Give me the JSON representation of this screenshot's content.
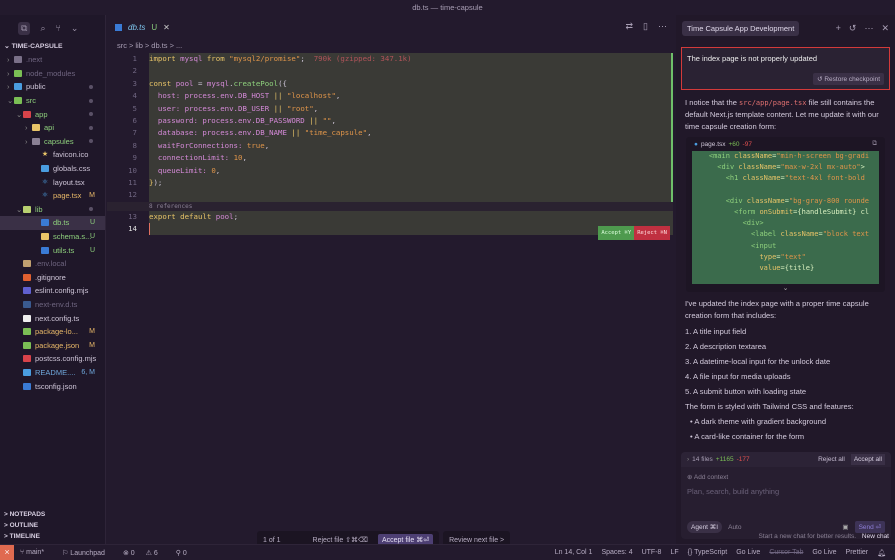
{
  "window": {
    "title": "db.ts — time-capsule"
  },
  "sidebar": {
    "project": "TIME-CAPSULE",
    "items": [
      {
        "label": ".next",
        "indent": 1,
        "chev": ">",
        "icon": "#7a7088",
        "dim": true
      },
      {
        "label": "node_modules",
        "indent": 1,
        "chev": ">",
        "icon": "#7bbf55",
        "dim": true
      },
      {
        "label": "public",
        "indent": 1,
        "chev": ">",
        "icon": "#4a9de0",
        "dot": true
      },
      {
        "label": "src",
        "indent": 1,
        "chev": "v",
        "icon": "#7bbf55",
        "dot": true,
        "color": "#8fd17d"
      },
      {
        "label": "app",
        "indent": 2,
        "chev": "v",
        "icon": "#d8434a",
        "dot": true,
        "color": "#8fd17d"
      },
      {
        "label": "api",
        "indent": 3,
        "chev": ">",
        "icon": "#e8c468",
        "dot": true,
        "color": "#8fd17d"
      },
      {
        "label": "capsules",
        "indent": 3,
        "chev": ">",
        "icon": "#8a8094",
        "dot": true,
        "color": "#8fd17d"
      },
      {
        "label": "favicon.ico",
        "indent": 4,
        "icon": "#e8c468",
        "glyph": "★"
      },
      {
        "label": "globals.css",
        "indent": 4,
        "icon": "#4a9de0"
      },
      {
        "label": "layout.tsx",
        "indent": 4,
        "icon": "#4a9de0",
        "glyph": "⚛"
      },
      {
        "label": "page.tsx",
        "indent": 4,
        "icon": "#4a9de0",
        "glyph": "⚛",
        "status": "M",
        "color": "#e8b868"
      },
      {
        "label": "lib",
        "indent": 2,
        "chev": "v",
        "icon": "#b8d070",
        "dot": true,
        "color": "#8fd17d"
      },
      {
        "label": "db.ts",
        "indent": 4,
        "icon": "#3a7bd5",
        "status": "U",
        "color": "#8fd17d",
        "selected": true
      },
      {
        "label": "schema.s...",
        "indent": 4,
        "icon": "#e8c468",
        "status": "U",
        "color": "#8fd17d"
      },
      {
        "label": "utils.ts",
        "indent": 4,
        "icon": "#3a7bd5",
        "status": "U",
        "color": "#8fd17d"
      },
      {
        "label": ".env.local",
        "indent": 2,
        "icon": "#c0a070",
        "dim": true
      },
      {
        "label": ".gitignore",
        "indent": 2,
        "icon": "#e06030"
      },
      {
        "label": "eslint.config.mjs",
        "indent": 2,
        "icon": "#6060d0"
      },
      {
        "label": "next-env.d.ts",
        "indent": 2,
        "icon": "#3a5a90",
        "dim": true
      },
      {
        "label": "next.config.ts",
        "indent": 2,
        "icon": "#eeeeee"
      },
      {
        "label": "package-lo...",
        "indent": 2,
        "icon": "#7bbf55",
        "status": "M",
        "color": "#e8b868"
      },
      {
        "label": "package.json",
        "indent": 2,
        "icon": "#7bbf55",
        "status": "M",
        "color": "#e8b868"
      },
      {
        "label": "postcss.config.mjs",
        "indent": 2,
        "icon": "#d8434a"
      },
      {
        "label": "README....",
        "indent": 2,
        "icon": "#4a9de0",
        "status": "6, M",
        "color": "#6fa8dc"
      },
      {
        "label": "tsconfig.json",
        "indent": 2,
        "icon": "#3a7bd5"
      }
    ],
    "sections": [
      "NOTEPADS",
      "OUTLINE",
      "TIMELINE"
    ]
  },
  "editor": {
    "tab": {
      "label": "db.ts",
      "status": "U"
    },
    "breadcrumb": [
      "src",
      ">",
      "lib",
      ">",
      "db.ts",
      ">",
      "..."
    ],
    "lines": [
      {
        "n": "1",
        "html": "<span class='kw'>import</span> <span class='vr'>mysql</span> <span class='kw'>from</span> <span class='str'>\"mysql2/promise\"</span>;  <span class='cm'>790k (gzipped: 347.1k)</span>"
      },
      {
        "n": "2",
        "html": ""
      },
      {
        "n": "3",
        "html": "<span class='kw'>const</span> <span class='vr'>pool</span> = <span class='vr'>mysql</span>.<span class='fn'>createPool</span>({"
      },
      {
        "n": "4",
        "html": "  <span class='vr'>host: process.env.DB_HOST</span> <span class='kw'>||</span> <span class='str'>\"localhost\"</span>,"
      },
      {
        "n": "5",
        "html": "  <span class='vr'>user: process.env.DB_USER</span> <span class='kw'>||</span> <span class='str'>\"root\"</span>,"
      },
      {
        "n": "6",
        "html": "  <span class='vr'>password: process.env.DB_PASSWORD</span> <span class='kw'>||</span> <span class='str'>\"\"</span>,"
      },
      {
        "n": "7",
        "html": "  <span class='vr'>database: process.env.DB_NAME</span> <span class='kw'>||</span> <span class='str'>\"time_capsule\"</span>,"
      },
      {
        "n": "8",
        "html": "  <span class='vr'>waitForConnections:</span> <span class='str'>true</span>,"
      },
      {
        "n": "9",
        "html": "  <span class='vr'>connectionLimit:</span> <span class='num'>10</span>,"
      },
      {
        "n": "10",
        "html": "  <span class='vr'>queueLimit:</span> <span class='num'>0</span>,"
      },
      {
        "n": "11",
        "html": "<span class='kw'>}</span>);"
      },
      {
        "n": "12",
        "html": ""
      }
    ],
    "references": "8 references",
    "line13": {
      "n": "13",
      "html": "<span class='kw'>export default</span> <span class='vr'>pool</span>;"
    },
    "line14": "14",
    "accept": "Accept ⌘Y",
    "reject": "Reject ⌘N",
    "review": {
      "counter": "1 of 1",
      "reject_file": "Reject file ⇧⌘⌫",
      "accept_file": "Accept file ⌘⏎",
      "review_next": "Review next file >"
    }
  },
  "chat": {
    "title": "Time Capsule App Development",
    "user_message": "The index page is not properly updated",
    "restore": "Restore checkpoint",
    "intro_a": "I notice that the ",
    "intro_code": "src/app/page.tsx",
    "intro_b": " file still contains the default Next.js template content. Let me update it with our time capsule creation form:",
    "codebox": {
      "file": "page.tsx",
      "added": "+60",
      "removed": "-97",
      "lines": [
        "    <span class='a'>&lt;main</span> <span class='t'>className</span>=<span class='s'>\"min-h-screen bg-gradi</span>",
        "      <span class='a'>&lt;div</span> <span class='t'>className</span>=<span class='s'>\"max-w-2xl mx-auto\"</span>&gt;",
        "        <span class='a'>&lt;h1</span> <span class='t'>className</span>=<span class='s'>\"text-4xl font-bold</span>",
        "",
        "        <span class='a'>&lt;div</span> <span class='t'>className</span>=<span class='s'>\"bg-gray-800 rounde</span>",
        "          <span class='a'>&lt;form</span> <span class='t'>onSubmit</span>={handleSubmit} cl",
        "            <span class='a'>&lt;div&gt;</span>",
        "              <span class='a'>&lt;label</span> <span class='t'>className</span>=<span class='s'>\"block text</span>",
        "              <span class='a'>&lt;input</span>",
        "                <span class='t'>type</span>=<span class='s'>\"text\"</span>",
        "                <span class='t'>value</span>={title}"
      ]
    },
    "summary": "I've updated the index page with a proper time capsule creation form that includes:",
    "list": [
      "1. A title input field",
      "2. A description textarea",
      "3. A datetime-local input for the unlock date",
      "4. A file input for media uploads",
      "5. A submit button with loading state"
    ],
    "styled": "The form is styled with Tailwind CSS and features:",
    "bullets": [
      "A dark theme with gradient background",
      "A card-like container for the form"
    ],
    "files": {
      "count": "14 files",
      "added": "+1165",
      "removed": "-177",
      "reject_all": "Reject all",
      "accept_all": "Accept all"
    },
    "add_context": "Add context",
    "placeholder": "Plan, search, build anything",
    "agent": "Agent ⌘I",
    "model": "Auto",
    "send": "Send ⏎",
    "hint": "Start a new chat for better results.",
    "new_chat": "New chat"
  },
  "status": {
    "branch": "main*",
    "launchpad": "Launchpad",
    "errors": "0",
    "warnings": "6",
    "ports": "0",
    "right": [
      "Ln 14, Col 1",
      "Spaces: 4",
      "UTF-8",
      "LF",
      "{} TypeScript",
      "Go Live",
      "Cursor Tab",
      "Go Live",
      "Prettier"
    ]
  },
  "colors": {
    "accent": "#8e7fd8",
    "highlight_border": "#d33a3a"
  }
}
